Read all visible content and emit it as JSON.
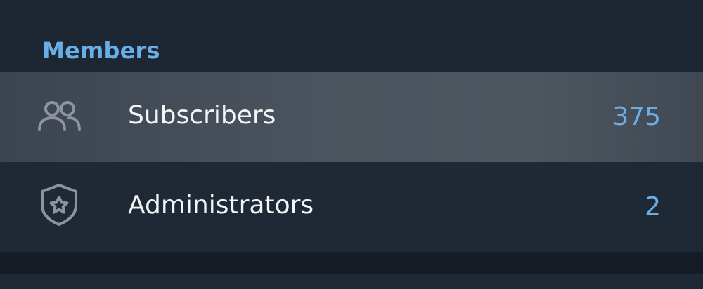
{
  "section": {
    "title": "Members"
  },
  "rows": [
    {
      "label": "Subscribers",
      "count": "375",
      "icon": "people-icon"
    },
    {
      "label": "Administrators",
      "count": "2",
      "icon": "shield-star-icon"
    }
  ],
  "colors": {
    "accent": "#6aaee6",
    "background": "#1d2633",
    "row_highlight": "#4b535e",
    "text_primary": "#f2f4f6",
    "icon": "#8c939c"
  }
}
